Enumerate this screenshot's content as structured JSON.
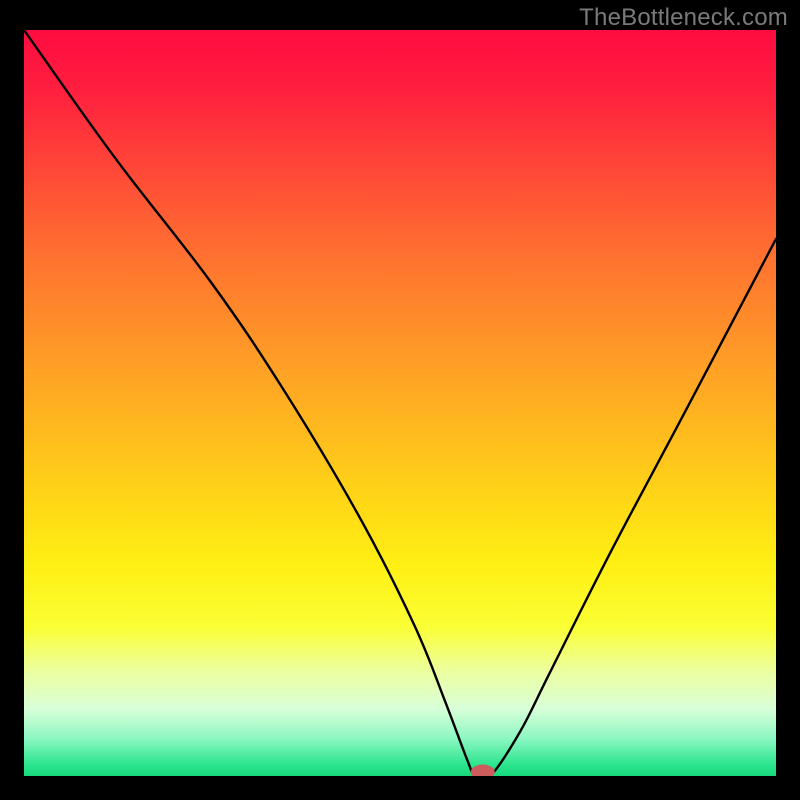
{
  "watermark": "TheBottleneck.com",
  "chart_data": {
    "type": "line",
    "title": "",
    "xlabel": "",
    "ylabel": "",
    "xlim": [
      0,
      100
    ],
    "ylim": [
      0,
      100
    ],
    "grid": false,
    "legend": false,
    "series": [
      {
        "name": "bottleneck-curve",
        "x": [
          0,
          12,
          25,
          35,
          45,
          52,
          56,
          59,
          60,
          62,
          66,
          70,
          78,
          88,
          100
        ],
        "values": [
          100,
          83,
          66,
          51,
          34,
          20,
          10,
          2,
          0,
          0,
          6,
          14,
          30,
          49,
          72
        ]
      }
    ],
    "marker": {
      "name": "optimal-point",
      "x": 61,
      "y": 0,
      "color": "#cd5c5c",
      "radius_x": 1.6,
      "radius_y": 1.0
    },
    "gradient_bands": [
      {
        "offset": 0.0,
        "color": "#ff0b40"
      },
      {
        "offset": 0.08,
        "color": "#ff1f3e"
      },
      {
        "offset": 0.18,
        "color": "#ff4538"
      },
      {
        "offset": 0.3,
        "color": "#ff7030"
      },
      {
        "offset": 0.42,
        "color": "#ff9628"
      },
      {
        "offset": 0.54,
        "color": "#ffbb1e"
      },
      {
        "offset": 0.64,
        "color": "#ffd916"
      },
      {
        "offset": 0.72,
        "color": "#fff014"
      },
      {
        "offset": 0.8,
        "color": "#fbff35"
      },
      {
        "offset": 0.86,
        "color": "#ecffa0"
      },
      {
        "offset": 0.91,
        "color": "#d8ffd8"
      },
      {
        "offset": 0.95,
        "color": "#8bf7c2"
      },
      {
        "offset": 0.985,
        "color": "#2be58e"
      },
      {
        "offset": 1.0,
        "color": "#17d87b"
      }
    ]
  }
}
